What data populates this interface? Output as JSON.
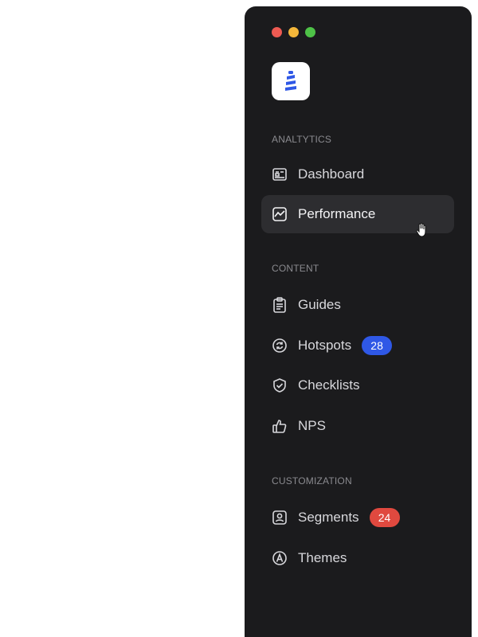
{
  "window": {
    "controls": [
      {
        "name": "close",
        "color": "#ee5a52"
      },
      {
        "name": "minimize",
        "color": "#f4b73a"
      },
      {
        "name": "zoom",
        "color": "#4ec247"
      }
    ]
  },
  "brand": {
    "logo_icon": "stacked-bars-logo",
    "accent": "#2f58e6"
  },
  "sections": [
    {
      "label": "ANALTYTICS",
      "items": [
        {
          "label": "Dashboard",
          "icon": "dashboard-icon",
          "active": false
        },
        {
          "label": "Performance",
          "icon": "chart-line-icon",
          "active": true
        }
      ]
    },
    {
      "label": "CONTENT",
      "items": [
        {
          "label": "Guides",
          "icon": "clipboard-icon",
          "active": false
        },
        {
          "label": "Hotspots",
          "icon": "refresh-circle-icon",
          "active": false,
          "badge": "28",
          "badge_color": "#2f58e6"
        },
        {
          "label": "Checklists",
          "icon": "shield-check-icon",
          "active": false
        },
        {
          "label": "NPS",
          "icon": "thumbs-up-icon",
          "active": false
        }
      ]
    },
    {
      "label": "CUSTOMIZATION",
      "items": [
        {
          "label": "Segments",
          "icon": "user-card-icon",
          "active": false,
          "badge": "24",
          "badge_color": "#e0493f"
        },
        {
          "label": "Themes",
          "icon": "theme-icon",
          "active": false
        }
      ]
    }
  ],
  "colors": {
    "sidebar_bg": "#1b1b1d",
    "active_bg": "#2d2d30",
    "text": "#d8d8dc",
    "section_text": "#8a8a8f"
  }
}
